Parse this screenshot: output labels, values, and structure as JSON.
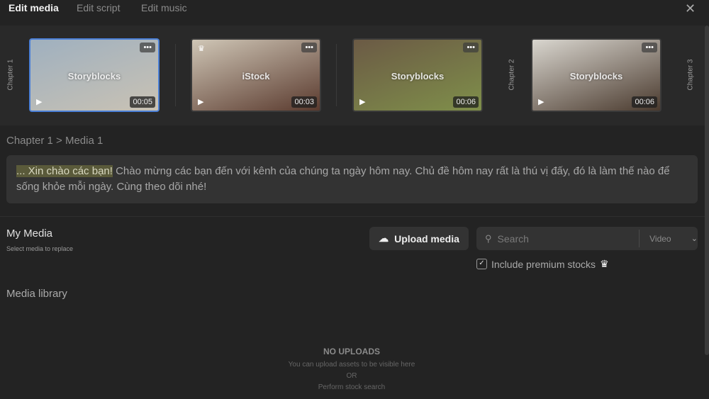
{
  "tabs": [
    {
      "label": "Edit media"
    },
    {
      "label": "Edit script"
    },
    {
      "label": "Edit music"
    }
  ],
  "chapters": [
    "Chapter 1",
    "Chapter 2",
    "Chapter 3"
  ],
  "thumbnails": [
    {
      "source": "Storyblocks",
      "duration": "00:05",
      "selected": true,
      "premium": false,
      "colors": [
        "#9fb0bf",
        "#c9c2b4"
      ]
    },
    {
      "source": "iStock",
      "duration": "00:03",
      "selected": false,
      "premium": true,
      "colors": [
        "#cfc6b6",
        "#5a3a2e"
      ]
    },
    {
      "source": "Storyblocks",
      "duration": "00:06",
      "selected": false,
      "premium": false,
      "colors": [
        "#6b5a45",
        "#7f8f4a"
      ]
    },
    {
      "source": "Storyblocks",
      "duration": "00:06",
      "selected": false,
      "premium": false,
      "colors": [
        "#d9d6cf",
        "#4a3a2e"
      ]
    }
  ],
  "breadcrumb": "Chapter 1 > Media 1",
  "script": {
    "highlight": "... Xin chào các bạn!",
    "rest": " Chào mừng các bạn đến với kênh của chúng ta ngày hôm nay. Chủ đề hôm nay rất là thú vị đấy, đó là làm thế nào để sống khỏe mỗi ngày. Cùng theo dõi nhé!"
  },
  "my_media": {
    "title": "My Media",
    "subtitle": "Select media to replace"
  },
  "upload_label": "Upload media",
  "search": {
    "placeholder": "Search",
    "type": "Video"
  },
  "premium_label": "Include premium stocks",
  "library": {
    "title": "Media library",
    "empty_title": "NO UPLOADS",
    "empty_line1": "You can upload assets to be visible here",
    "or": "OR",
    "empty_line2": "Perform stock search"
  }
}
